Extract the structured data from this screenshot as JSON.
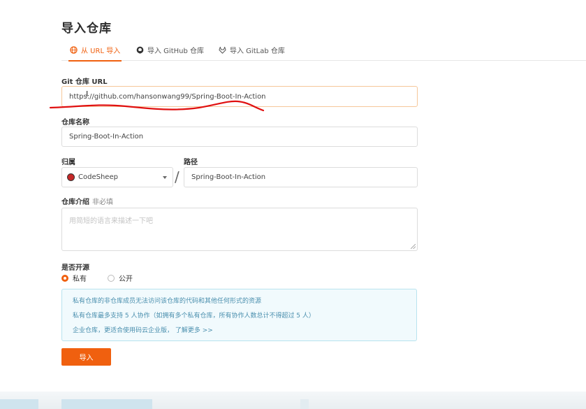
{
  "page": {
    "title": "导入仓库"
  },
  "tabs": [
    {
      "label": "从 URL 导入",
      "icon": "globe-icon",
      "active": true
    },
    {
      "label": "导入 GitHub 仓库",
      "icon": "github-icon",
      "active": false
    },
    {
      "label": "导入 GitLab 仓库",
      "icon": "gitlab-icon",
      "active": false
    }
  ],
  "form": {
    "git_url_label": "Git 仓库 URL",
    "git_url_value": "https://github.com/hansonwang99/Spring-Boot-In-Action",
    "repo_name_label": "仓库名称",
    "repo_name_value": "Spring-Boot-In-Action",
    "owner_label": "归属",
    "owner_value": "CodeSheep",
    "path_label": "路径",
    "path_value": "Spring-Boot-In-Action",
    "slash": "/",
    "description_label": "仓库介绍",
    "description_optional": "非必填",
    "description_placeholder": "用简短的语言来描述一下吧",
    "visibility_label": "是否开源",
    "visibility_options": [
      {
        "label": "私有",
        "checked": true
      },
      {
        "label": "公开",
        "checked": false
      }
    ],
    "info_lines": [
      "私有仓库的非仓库成员无法访问该仓库的代码和其他任何形式的资源",
      "私有仓库最多支持 5 人协作（如拥有多个私有仓库，所有协作人数总计不得超过 5 人）",
      "企业仓库，更适合使用码云企业版， 了解更多 >>"
    ],
    "submit_label": "导入"
  },
  "colors": {
    "accent": "#f0600f",
    "info_bg": "#f1fafd",
    "info_border": "#b8e3ef",
    "info_text": "#4a8fae",
    "annotation": "#e01010"
  }
}
